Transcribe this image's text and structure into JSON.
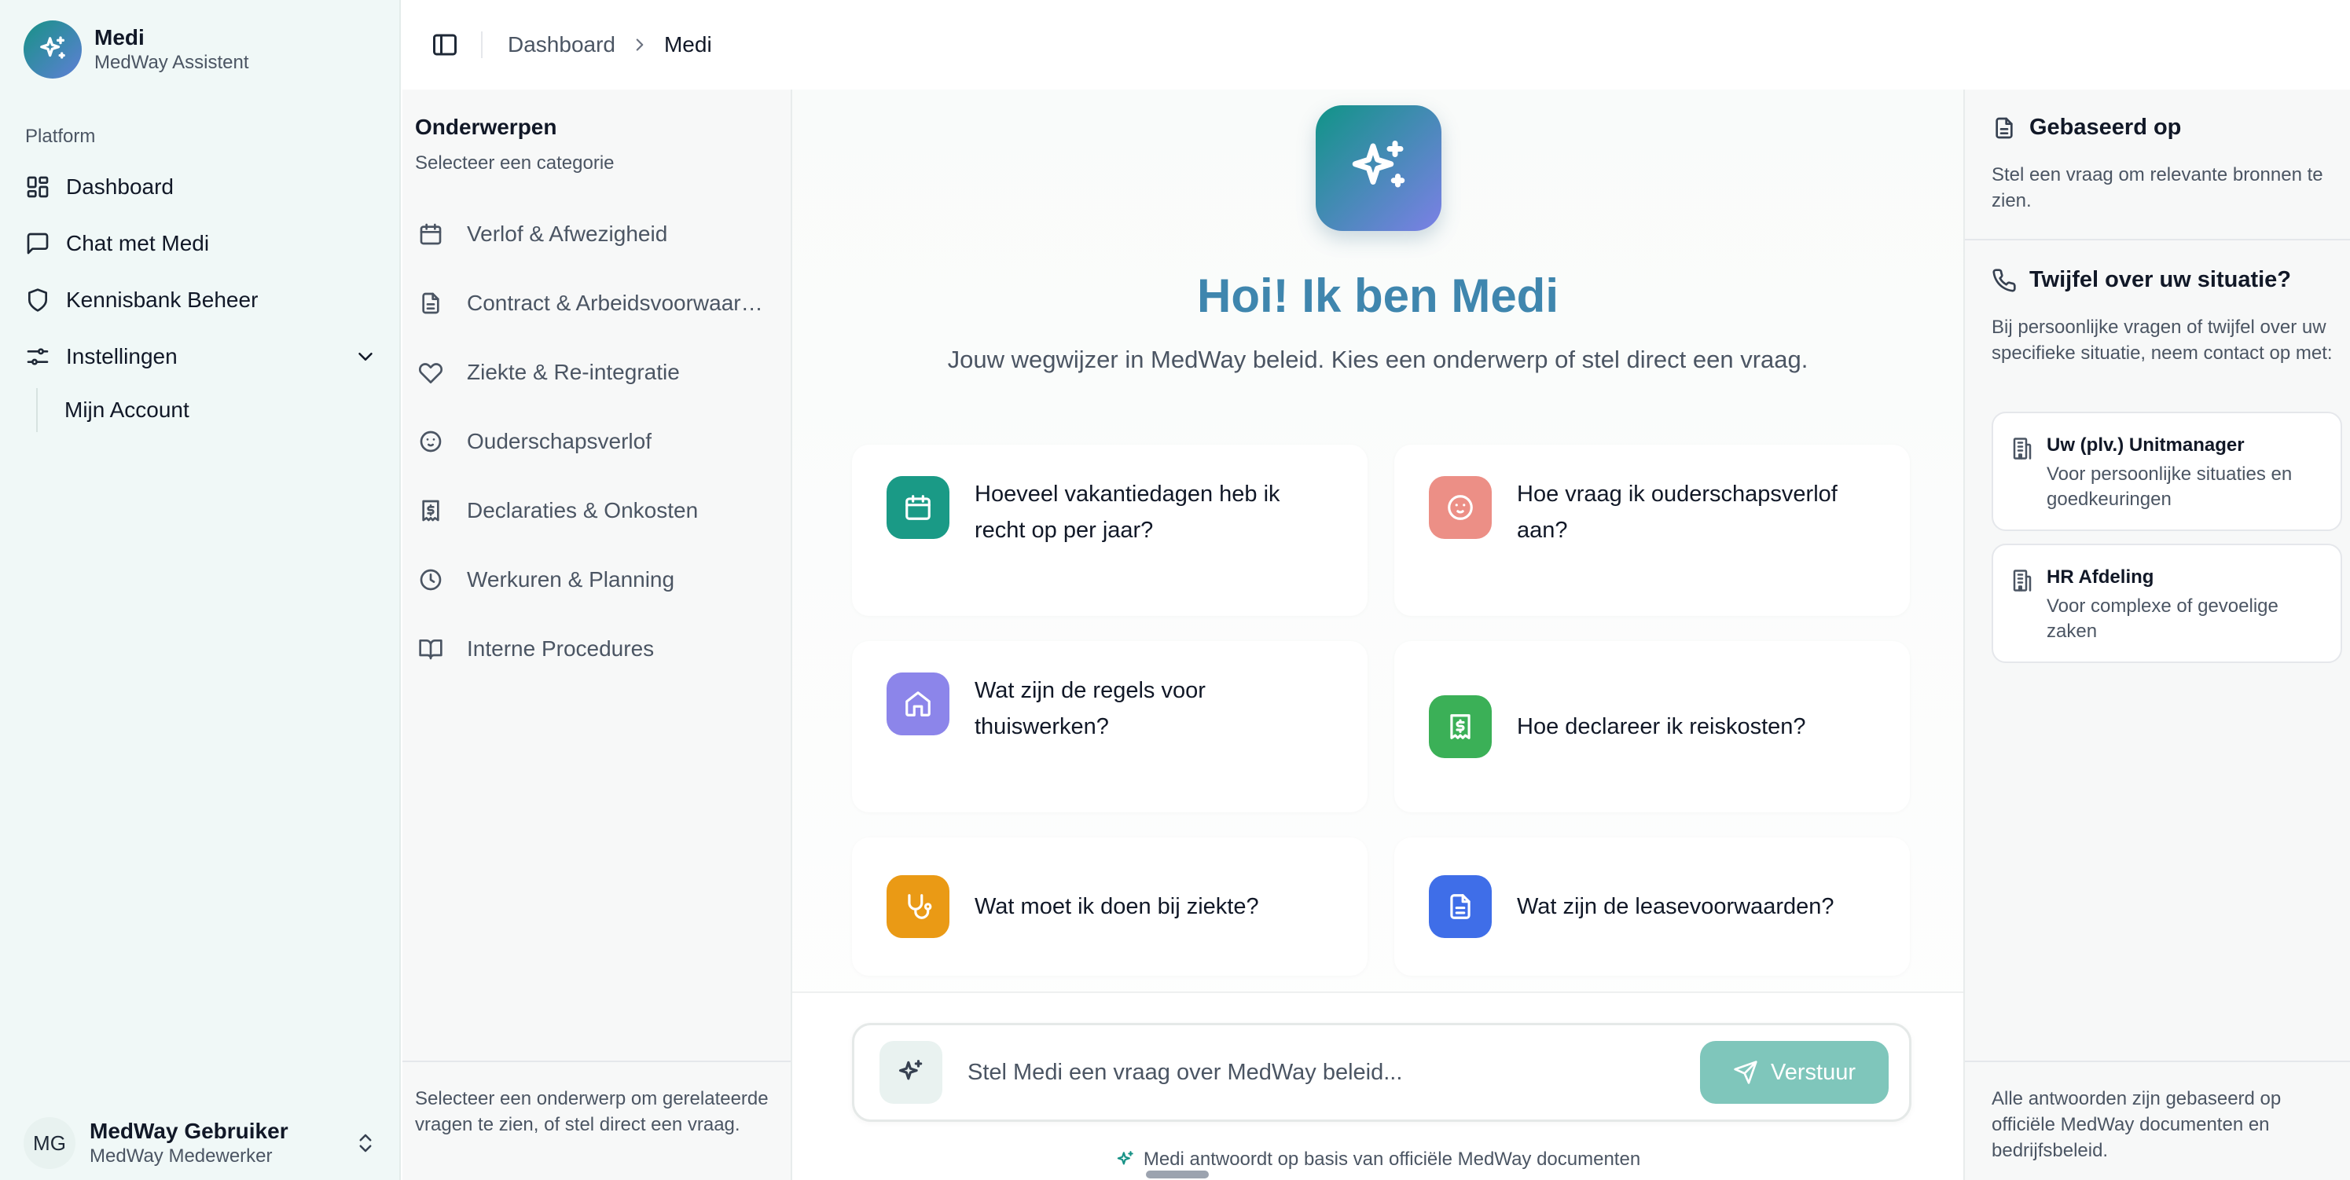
{
  "colors": {
    "brand_teal": "#179286",
    "brand_blue": "#5f7fd6",
    "title_blue": "#3f86ae",
    "send_bg": "#7fc6bb"
  },
  "sidebar": {
    "app_name": "Medi",
    "app_sub": "MedWay Assistent",
    "section": "Platform",
    "items": [
      {
        "label": "Dashboard",
        "icon": "dashboard-icon"
      },
      {
        "label": "Chat met Medi",
        "icon": "chat-icon"
      },
      {
        "label": "Kennisbank Beheer",
        "icon": "shield-icon"
      },
      {
        "label": "Instellingen",
        "icon": "settings-sliders-icon"
      }
    ],
    "sub_items": [
      {
        "label": "Mijn Account"
      }
    ],
    "user": {
      "initials": "MG",
      "name": "MedWay Gebruiker",
      "role": "MedWay Medewerker"
    }
  },
  "header": {
    "crumb_parent": "Dashboard",
    "crumb_current": "Medi"
  },
  "topics": {
    "title": "Onderwerpen",
    "subtitle": "Selecteer een categorie",
    "items": [
      {
        "label": "Verlof & Afwezigheid",
        "icon": "calendar-icon"
      },
      {
        "label": "Contract & Arbeidsvoorwaarden",
        "icon": "document-icon"
      },
      {
        "label": "Ziekte & Re-integratie",
        "icon": "heart-icon"
      },
      {
        "label": "Ouderschapsverlof",
        "icon": "baby-icon"
      },
      {
        "label": "Declaraties & Onkosten",
        "icon": "receipt-icon"
      },
      {
        "label": "Werkuren & Planning",
        "icon": "clock-icon"
      },
      {
        "label": "Interne Procedures",
        "icon": "book-icon"
      }
    ],
    "footer": "Selecteer een onderwerp om gerelateerde vragen te zien, of stel direct een vraag."
  },
  "main": {
    "title": "Hoi! Ik ben Medi",
    "subtitle": "Jouw wegwijzer in MedWay beleid. Kies een onderwerp of stel direct een vraag.",
    "cards": [
      {
        "text": "Hoeveel vakantiedagen heb ik recht op per jaar?",
        "icon": "calendar-icon",
        "color": "#1a9a86"
      },
      {
        "text": "Hoe vraag ik ouderschapsverlof aan?",
        "icon": "baby-icon",
        "color": "#ec8f86"
      },
      {
        "text": "Wat zijn de regels voor thuiswerken?",
        "icon": "home-icon",
        "color": "#8c85ea"
      },
      {
        "text": "Hoe declareer ik reiskosten?",
        "icon": "receipt-icon",
        "color": "#3bb057"
      },
      {
        "text": "Wat moet ik doen bij ziekte?",
        "icon": "stethoscope-icon",
        "color": "#ea9a15"
      },
      {
        "text": "Wat zijn de leasevoorwaarden?",
        "icon": "document-icon",
        "color": "#3f6ee8"
      }
    ],
    "input_placeholder": "Stel Medi een vraag over MedWay beleid...",
    "send_label": "Verstuur",
    "footnote": "Medi antwoordt op basis van officiële MedWay documenten"
  },
  "right": {
    "sources_title": "Gebaseerd op",
    "sources_text": "Stel een vraag om relevante bronnen te zien.",
    "doubt_title": "Twijfel over uw situatie?",
    "doubt_text": "Bij persoonlijke vragen of twijfel over uw specifieke situatie, neem contact op met:",
    "contacts": [
      {
        "title": "Uw (plv.) Unitmanager",
        "sub": "Voor persoonlijke situaties en goedkeuringen"
      },
      {
        "title": "HR Afdeling",
        "sub": "Voor complexe of gevoelige zaken"
      }
    ],
    "footer": "Alle antwoorden zijn gebaseerd op officiële MedWay documenten en bedrijfsbeleid."
  }
}
